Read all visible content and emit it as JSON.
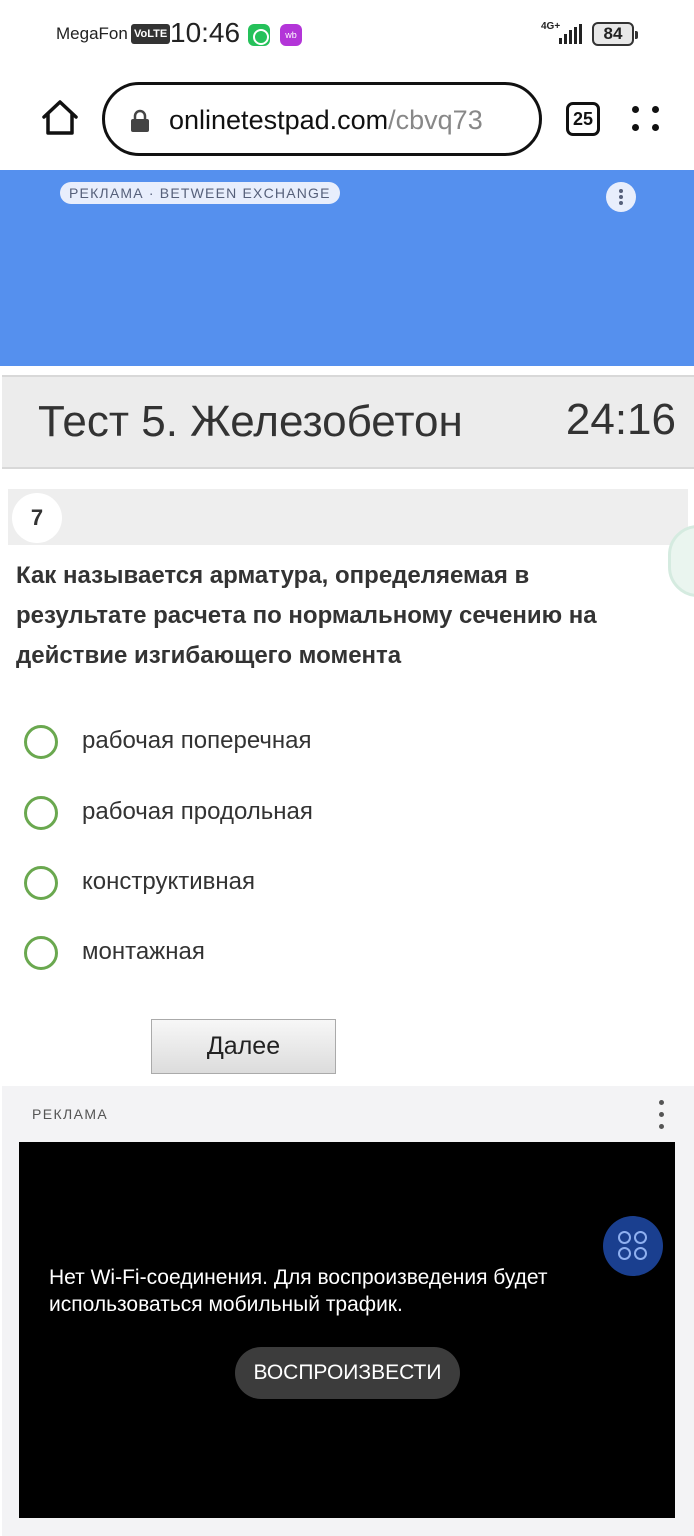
{
  "status_bar": {
    "carrier": "MegaFon",
    "volte": "VoLTE",
    "time": "10:46",
    "wb_icon_text": "wb",
    "network": "4G+",
    "battery": "84"
  },
  "browser": {
    "url_domain": "onlinetestpad.com",
    "url_path": "/cbvq73",
    "tabs_count": "25"
  },
  "top_ad": {
    "label": "РЕКЛАМА · BETWEEN EXCHANGE",
    "color": "#5590ee"
  },
  "test": {
    "title": "Тест 5. Железобетон",
    "timer": "24:16"
  },
  "question": {
    "number": "7",
    "text": "Как называется арматура, определяемая в результате расчета по нормальному сечению на действие изгибающего момента",
    "options": [
      "рабочая поперечная",
      "рабочая продольная",
      "конструктивная",
      "монтажная"
    ],
    "next_label": "Далее"
  },
  "bottom_ad": {
    "label": "РЕКЛАМА",
    "wifi_message": "Нет Wi-Fi-соединения. Для воспроизведения будет использоваться мобильный трафик.",
    "play_label": "ВОСПРОИЗВЕСТИ"
  },
  "colors": {
    "radio_border": "#6aa84f",
    "header_bg": "#ececec"
  }
}
